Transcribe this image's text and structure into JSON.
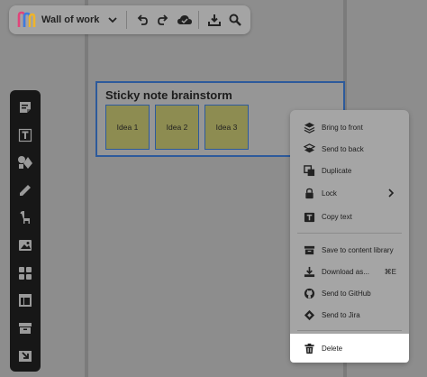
{
  "toolbar": {
    "board_name": "Wall of work",
    "buttons": [
      "chevron-down",
      "undo",
      "redo",
      "cloud-save",
      "download",
      "search"
    ]
  },
  "left_tools": [
    "sticky-note",
    "text",
    "shapes",
    "pen",
    "llama",
    "image",
    "grid",
    "table",
    "archive",
    "import"
  ],
  "frame": {
    "title": "Sticky note brainstorm",
    "notes": [
      "Idea 1",
      "Idea 2",
      "Idea 3"
    ]
  },
  "context_menu": {
    "items": [
      {
        "label": "Bring to front",
        "icon": "layer-up"
      },
      {
        "label": "Send to back",
        "icon": "layer-down"
      },
      {
        "label": "Duplicate",
        "icon": "copy"
      },
      {
        "label": "Lock",
        "icon": "lock",
        "submenu": true
      },
      {
        "label": "Copy text",
        "icon": "text-copy"
      },
      {
        "label": "Save to content library",
        "icon": "library"
      },
      {
        "label": "Download as...",
        "icon": "download",
        "shortcut": "⌘E"
      },
      {
        "label": "Send to GitHub",
        "icon": "github"
      },
      {
        "label": "Send to Jira",
        "icon": "jira"
      },
      {
        "label": "Delete",
        "icon": "trash"
      }
    ]
  },
  "colors": {
    "overlay": "#8d8d8d",
    "frame_border": "#2d5a9b",
    "sticky": "#8d8c51",
    "left_toolbar": "#171717",
    "delete_highlight": "#ffffff"
  }
}
